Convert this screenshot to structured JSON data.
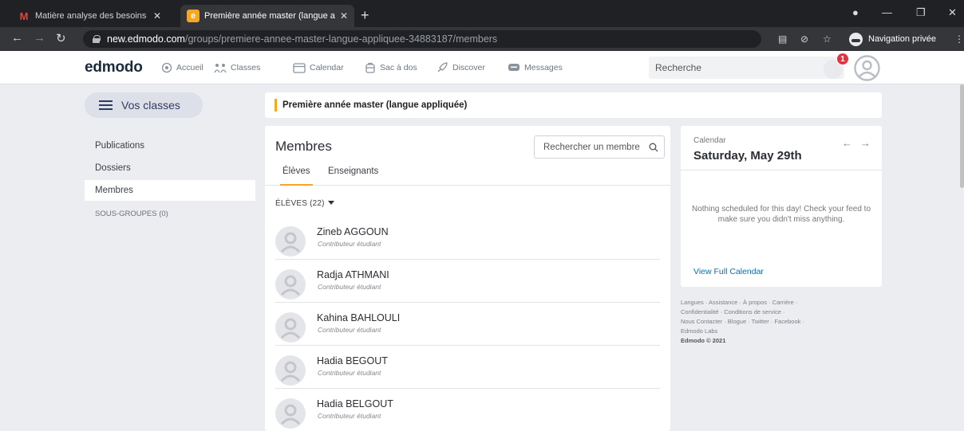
{
  "browser": {
    "tabs": [
      {
        "title": "Matière analyse des besoins et c",
        "close": "✕"
      },
      {
        "title": "Première année master (langue a",
        "close": "✕"
      }
    ],
    "new_tab": "+",
    "url_host": "new.edmodo.com",
    "url_path": "/groups/premiere-annee-master-langue-appliquee-34883187/members",
    "incognito_label": "Navigation privée"
  },
  "header": {
    "logo": "edmodo",
    "nav": [
      "Accueil",
      "Classes",
      "Calendar",
      "Sac à dos",
      "Discover",
      "Messages"
    ],
    "search_placeholder": "Recherche",
    "notification_count": "1"
  },
  "sidebar": {
    "toggle_label": "Vos classes",
    "items": [
      "Publications",
      "Dossiers",
      "Membres"
    ],
    "subgroups": "SOUS-GROUPES (0)"
  },
  "class_name": "Première année master (langue appliquée)",
  "members": {
    "title": "Membres",
    "search_placeholder": "Rechercher un membre",
    "tabs": [
      "Élèves",
      "Enseignants"
    ],
    "filter_label": "ÉLÈVES (22)",
    "list": [
      {
        "name": "Zineb AGGOUN",
        "role": "Contributeur étudiant"
      },
      {
        "name": "Radja ATHMANI",
        "role": "Contributeur étudiant"
      },
      {
        "name": "Kahina BAHLOULI",
        "role": "Contributeur étudiant"
      },
      {
        "name": "Hadia BEGOUT",
        "role": "Contributeur étudiant"
      },
      {
        "name": "Hadia BELGOUT",
        "role": "Contributeur étudiant"
      }
    ]
  },
  "calendar": {
    "label": "Calendar",
    "date": "Saturday, May 29th",
    "empty_message": "Nothing scheduled for this day! Check your feed to make sure you didn't miss anything.",
    "view_full": "View Full Calendar"
  },
  "footer": {
    "links": [
      "Langues",
      "Assistance",
      "À propos",
      "Carrière",
      "Confidentialité",
      "Conditions de service",
      "Nous Contacter",
      "Blogue",
      "Twitter",
      "Facebook",
      "Edmodo Labs"
    ],
    "copyright": "Edmodo © 2021"
  },
  "colors": {
    "accent": "#f5a623",
    "link": "#0a6fb0",
    "badge": "#e5323b",
    "background": "#ecedf0"
  }
}
